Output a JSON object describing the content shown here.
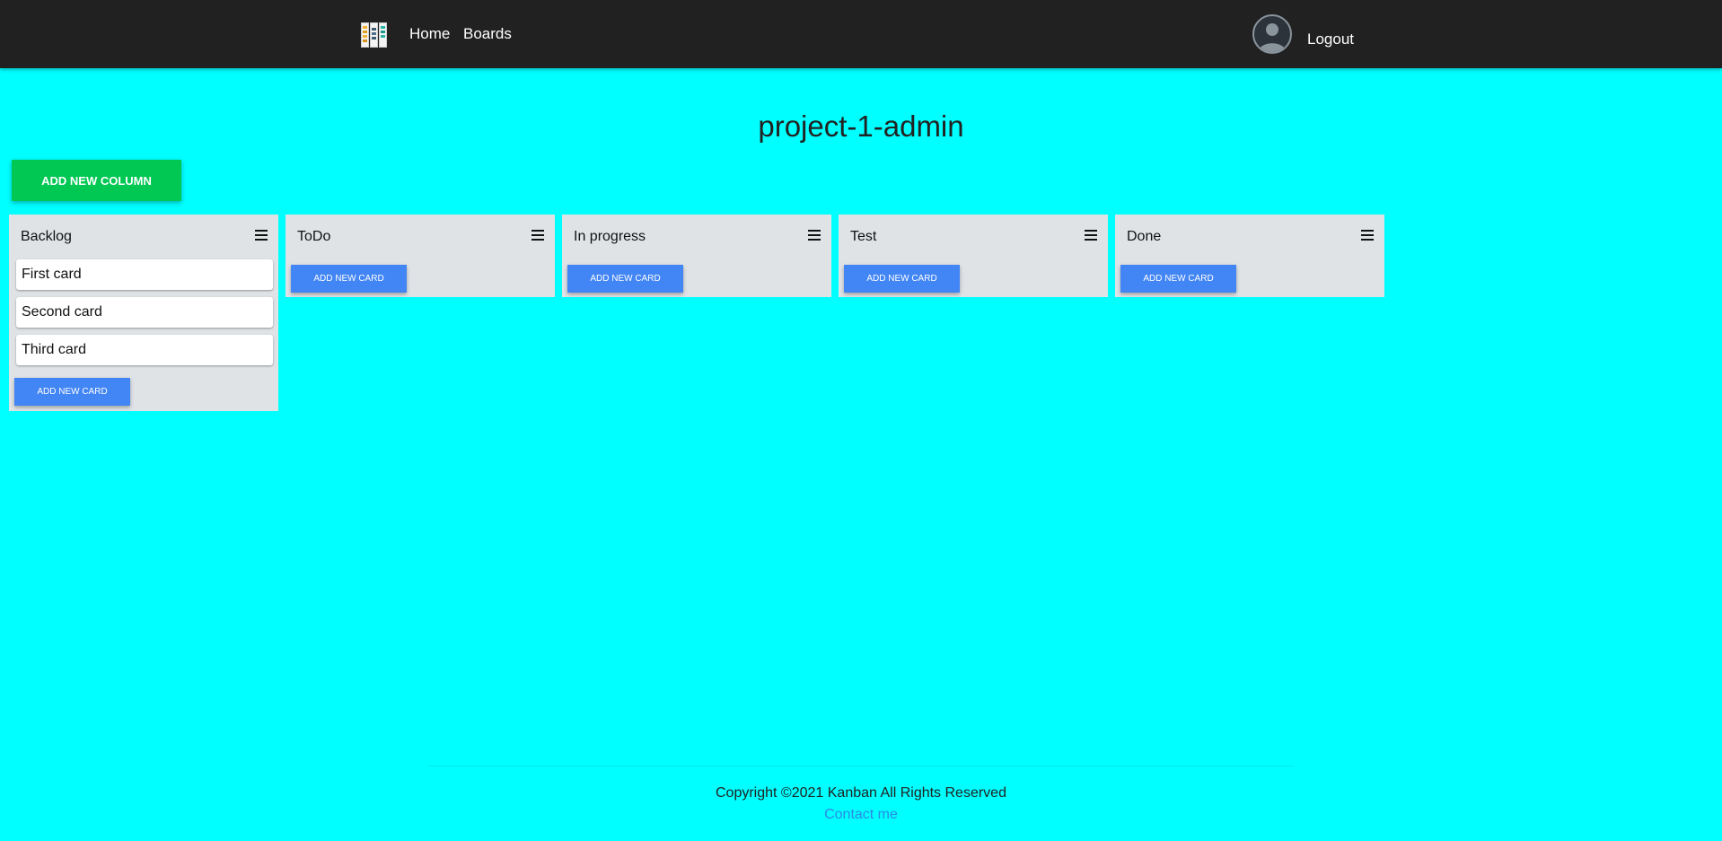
{
  "colors": {
    "background": "#00ffff",
    "navbar": "#212121",
    "add_column_button": "#00c853",
    "add_card_button": "#4285f4",
    "column_background": "#dfe3e6",
    "link": "#2b8ae8"
  },
  "navbar": {
    "logo_icon": "kanban-board-icon",
    "home_label": "Home",
    "boards_label": "Boards",
    "avatar_icon": "user-avatar-icon",
    "logout_label": "Logout"
  },
  "board": {
    "title": "project-1-admin",
    "add_column_label": "ADD NEW COLUMN",
    "columns": [
      {
        "title": "Backlog",
        "cards": [
          "First card",
          "Second card",
          "Third card"
        ],
        "add_card_label": "ADD NEW CARD"
      },
      {
        "title": "ToDo",
        "cards": [],
        "add_card_label": "ADD NEW CARD"
      },
      {
        "title": "In progress",
        "cards": [],
        "add_card_label": "ADD NEW CARD"
      },
      {
        "title": "Test",
        "cards": [],
        "add_card_label": "ADD NEW CARD"
      },
      {
        "title": "Done",
        "cards": [],
        "add_card_label": "ADD NEW CARD"
      }
    ]
  },
  "footer": {
    "copyright": "Copyright ©2021 Kanban All Rights Reserved",
    "contact_label": "Contact me"
  }
}
